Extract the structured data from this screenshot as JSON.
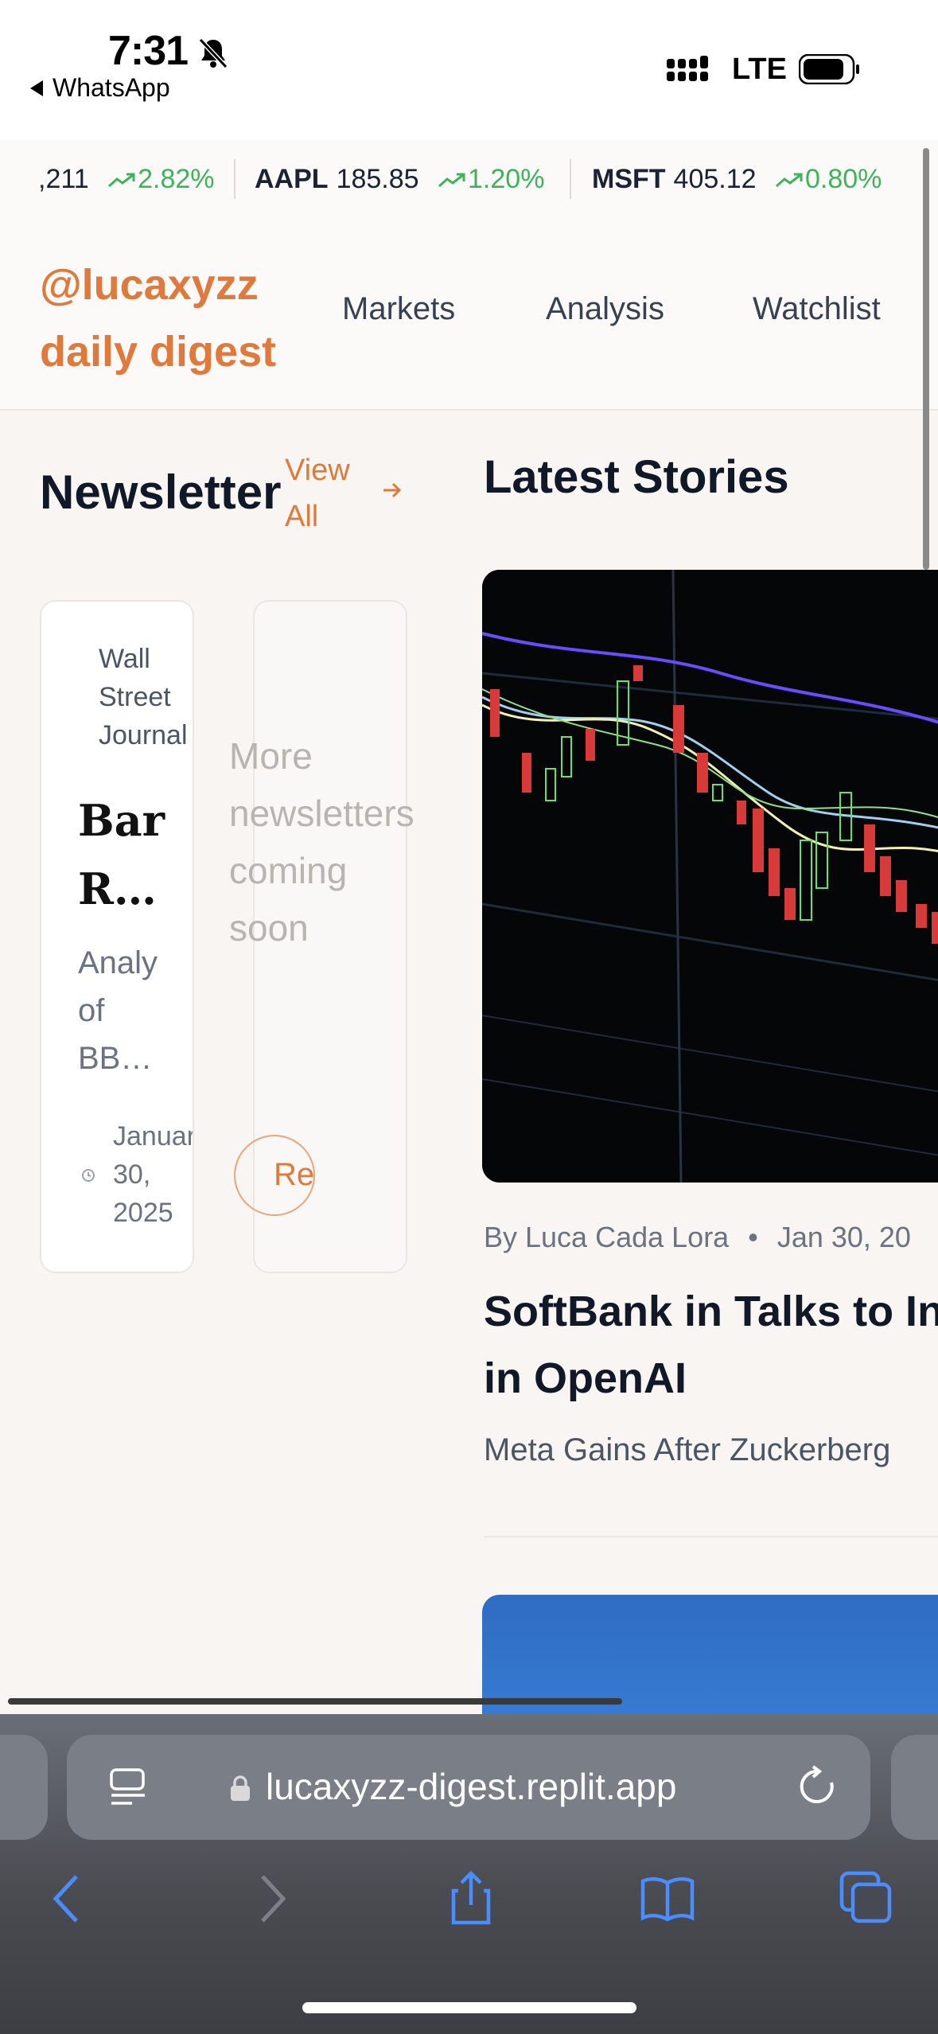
{
  "status": {
    "time": "7:31",
    "back_app": "WhatsApp",
    "network": "LTE"
  },
  "ticker": [
    {
      "symbol": "",
      "price": ",211",
      "change": "2.82%"
    },
    {
      "symbol": "AAPL",
      "price": "185.85",
      "change": "1.20%"
    },
    {
      "symbol": "MSFT",
      "price": "405.12",
      "change": "0.80%"
    }
  ],
  "header": {
    "brand_line1": "@lucaxyzz",
    "brand_line2": "daily digest",
    "nav": [
      "Markets",
      "Analysis",
      "Watchlist"
    ]
  },
  "newsletter": {
    "title": "Newsletter",
    "view_all_1": "View",
    "view_all_2": "All",
    "card": {
      "source": [
        "Wall",
        "Street",
        "Journal"
      ],
      "title": [
        "Bar",
        "R…"
      ],
      "desc": [
        "Analy",
        "of",
        "BB…"
      ],
      "date": [
        "January",
        "30,",
        "2025"
      ]
    },
    "placeholder": [
      "More",
      "newsletters",
      "coming",
      "soon"
    ],
    "read_button": "Re"
  },
  "latest": {
    "title": "Latest Stories",
    "story": {
      "author": "By Luca Cada Lora",
      "date": "Jan 30, 20",
      "headline_1": "SoftBank in Talks to Inv",
      "headline_2": "in OpenAI",
      "subtitle": "Meta Gains After Zuckerberg"
    }
  },
  "browser": {
    "url": "lucaxyzz-digest.replit.app"
  },
  "colors": {
    "accent": "#e07a3c",
    "positive": "#3fb35b"
  }
}
